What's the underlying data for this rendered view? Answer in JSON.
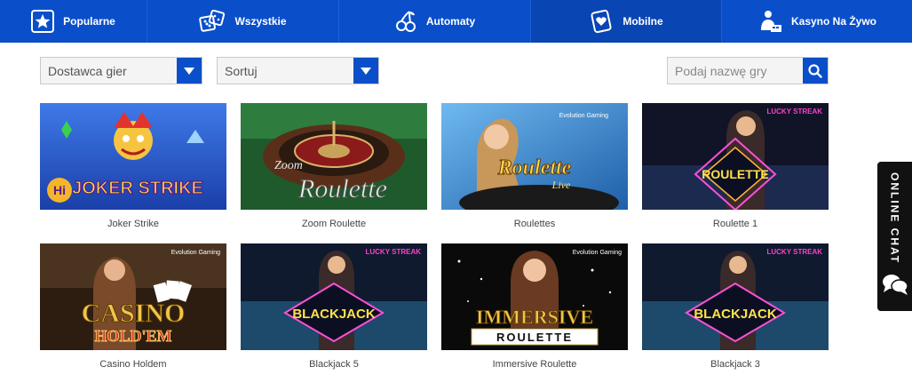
{
  "nav": {
    "items": [
      {
        "label": "Popularne",
        "icon": "star-icon"
      },
      {
        "label": "Wszystkie",
        "icon": "dice-icon"
      },
      {
        "label": "Automaty",
        "icon": "cherries-icon"
      },
      {
        "label": "Mobilne",
        "icon": "mobile-heart-icon"
      },
      {
        "label": "Kasyno Na Żywo",
        "icon": "live-dealer-icon"
      }
    ],
    "active_index": 3
  },
  "filters": {
    "provider_label": "Dostawca gier",
    "sort_label": "Sortuj",
    "search_placeholder": "Podaj nazwę gry"
  },
  "games": [
    {
      "name": "Joker Strike",
      "art_title": "JOKER STRIKE",
      "art_badge": "Hi",
      "accent": "#2c5bd6"
    },
    {
      "name": "Zoom Roulette",
      "art_title": "Zoom",
      "art_subtitle": "Roulette",
      "accent": "#2a7a3a"
    },
    {
      "name": "Roulettes",
      "art_title": "Roulette",
      "art_subtitle": "Live",
      "art_brand": "Evolution Gaming",
      "accent": "#3a8fd8"
    },
    {
      "name": "Roulette 1",
      "art_title": "ROULETTE",
      "art_brand": "LUCKY STREAK",
      "accent": "#1c1f3a"
    },
    {
      "name": "Casino Holdem",
      "art_title": "CASINO",
      "art_subtitle": "HOLD'EM",
      "art_brand": "Evolution Gaming",
      "accent": "#5a3a1e"
    },
    {
      "name": "Blackjack 5",
      "art_title": "BLACKJACK",
      "art_brand": "LUCKY STREAK",
      "accent": "#1b3550"
    },
    {
      "name": "Immersive Roulette",
      "art_title": "IMMERSIVE",
      "art_subtitle": "ROULETTE",
      "art_brand": "Evolution Gaming",
      "accent": "#111111"
    },
    {
      "name": "Blackjack 3",
      "art_title": "BLACKJACK",
      "art_brand": "LUCKY STREAK",
      "accent": "#1b3550"
    }
  ],
  "chat": {
    "label": "ONLINE CHAT",
    "icon": "chat-bubbles-icon"
  },
  "colors": {
    "brand_blue": "#0a4fc9",
    "nav_active": "#0a45b4",
    "chat_bg": "#111111"
  }
}
